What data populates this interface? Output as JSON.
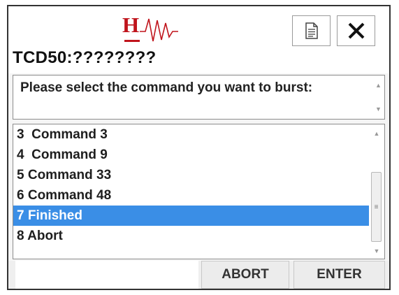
{
  "window": {
    "logo_letter": "H",
    "title": "TCD50:????????",
    "doc_icon": "document-icon",
    "close_icon": "close-icon"
  },
  "prompt": {
    "text": "Please select the command you want to burst:"
  },
  "list": {
    "items": [
      {
        "label": "3  Command 3",
        "selected": false
      },
      {
        "label": "4  Command 9",
        "selected": false
      },
      {
        "label": "5 Command 33",
        "selected": false
      },
      {
        "label": "6 Command 48",
        "selected": false
      },
      {
        "label": "7 Finished",
        "selected": true
      },
      {
        "label": "8 Abort",
        "selected": false
      }
    ]
  },
  "buttons": {
    "abort_label": "ABORT",
    "enter_label": "ENTER"
  },
  "colors": {
    "selection": "#3a8ee6",
    "logo": "#c0141c"
  }
}
